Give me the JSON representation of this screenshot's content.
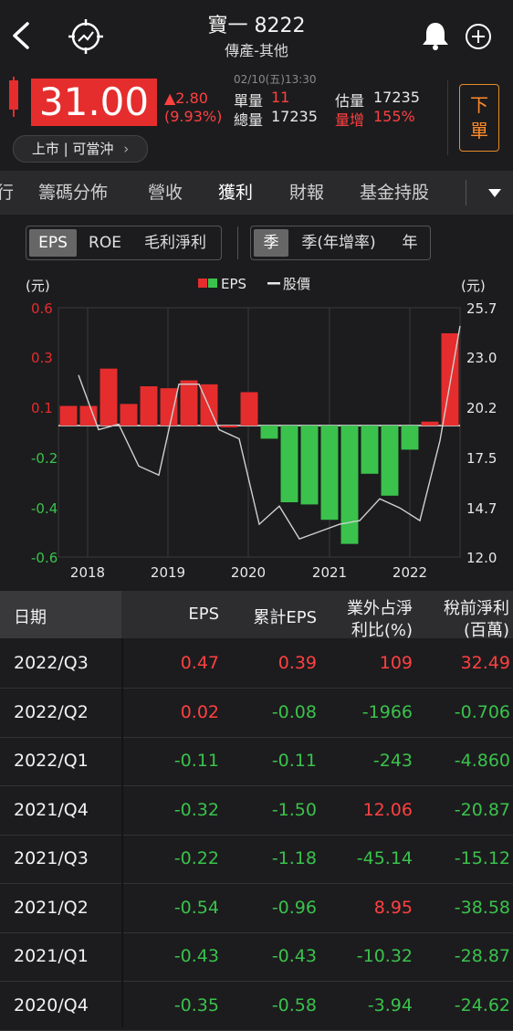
{
  "header": {
    "title": "寶一 8222",
    "subtitle": "傳產-其他"
  },
  "quote": {
    "price": "31.00",
    "change": "▲2.80",
    "change_pct": "(9.93%)",
    "datetime": "02/10(五)13:30",
    "unit_vol_label": "單量",
    "unit_vol_value": "11",
    "total_vol_label": "總量",
    "total_vol_value": "17235",
    "est_vol_label": "估量",
    "est_vol_value": "17235",
    "vol_increase_label": "量增",
    "vol_increase_value": "155%",
    "market_tag": "上市 | 可當沖",
    "order_label_1": "下",
    "order_label_2": "單",
    "colors": {
      "up": "#e52d2d",
      "down": "#3ac24c",
      "accent": "#ff8a2a"
    }
  },
  "tabs": [
    {
      "label": "行"
    },
    {
      "label": "籌碼分佈"
    },
    {
      "label": "營收"
    },
    {
      "label": "獲利",
      "active": true
    },
    {
      "label": "財報"
    },
    {
      "label": "基金持股"
    }
  ],
  "filters": {
    "metric": [
      "EPS",
      "ROE",
      "毛利淨利"
    ],
    "metric_selected": "EPS",
    "period": [
      "季",
      "季(年增率)",
      "年"
    ],
    "period_selected": "季"
  },
  "chart_data": {
    "type": "bar",
    "left_unit": "(元)",
    "right_unit": "(元)",
    "legend_eps": "EPS",
    "legend_price": "股價",
    "left_ticks": [
      "0.6",
      "0.3",
      "0.1",
      "-0.2",
      "-0.4",
      "-0.6"
    ],
    "right_ticks": [
      "25.7",
      "23.0",
      "20.2",
      "17.5",
      "14.7",
      "12.0"
    ],
    "x_ticks": [
      "2018",
      "2019",
      "2020",
      "2021",
      "2022"
    ],
    "ylim_eps": [
      -0.6,
      0.6
    ],
    "ylim_price": [
      12.0,
      25.7
    ],
    "eps": [
      0.1,
      0.1,
      0.29,
      0.11,
      0.2,
      0.19,
      0.23,
      0.21,
      0.0,
      0.17,
      -0.06,
      -0.35,
      -0.36,
      -0.43,
      -0.54,
      -0.22,
      -0.32,
      -0.11,
      0.02,
      0.47
    ],
    "price": [
      22.0,
      19.0,
      19.3,
      17.0,
      16.5,
      21.5,
      21.5,
      19.0,
      18.5,
      13.8,
      14.8,
      13.0,
      13.4,
      13.8,
      14.0,
      15.2,
      14.7,
      14.0,
      18.4,
      24.7
    ]
  },
  "table": {
    "headers": {
      "date": "日期",
      "eps": "EPS",
      "cum_eps": "累計EPS",
      "nonop_1": "業外占淨",
      "nonop_2": "利比(%)",
      "pretax_1": "稅前淨利",
      "pretax_2": "(百萬)"
    },
    "rows": [
      {
        "date": "2022/Q3",
        "eps": "0.47",
        "cum": "0.39",
        "nonop": "109",
        "pretax": "32.49"
      },
      {
        "date": "2022/Q2",
        "eps": "0.02",
        "cum": "-0.08",
        "nonop": "-1966",
        "pretax": "-0.706"
      },
      {
        "date": "2022/Q1",
        "eps": "-0.11",
        "cum": "-0.11",
        "nonop": "-243",
        "pretax": "-4.860"
      },
      {
        "date": "2021/Q4",
        "eps": "-0.32",
        "cum": "-1.50",
        "nonop": "12.06",
        "pretax": "-20.87"
      },
      {
        "date": "2021/Q3",
        "eps": "-0.22",
        "cum": "-1.18",
        "nonop": "-45.14",
        "pretax": "-15.12"
      },
      {
        "date": "2021/Q2",
        "eps": "-0.54",
        "cum": "-0.96",
        "nonop": "8.95",
        "pretax": "-38.58"
      },
      {
        "date": "2021/Q1",
        "eps": "-0.43",
        "cum": "-0.43",
        "nonop": "-10.32",
        "pretax": "-28.87"
      },
      {
        "date": "2020/Q4",
        "eps": "-0.35",
        "cum": "-0.58",
        "nonop": "-3.94",
        "pretax": "-24.62"
      }
    ]
  }
}
